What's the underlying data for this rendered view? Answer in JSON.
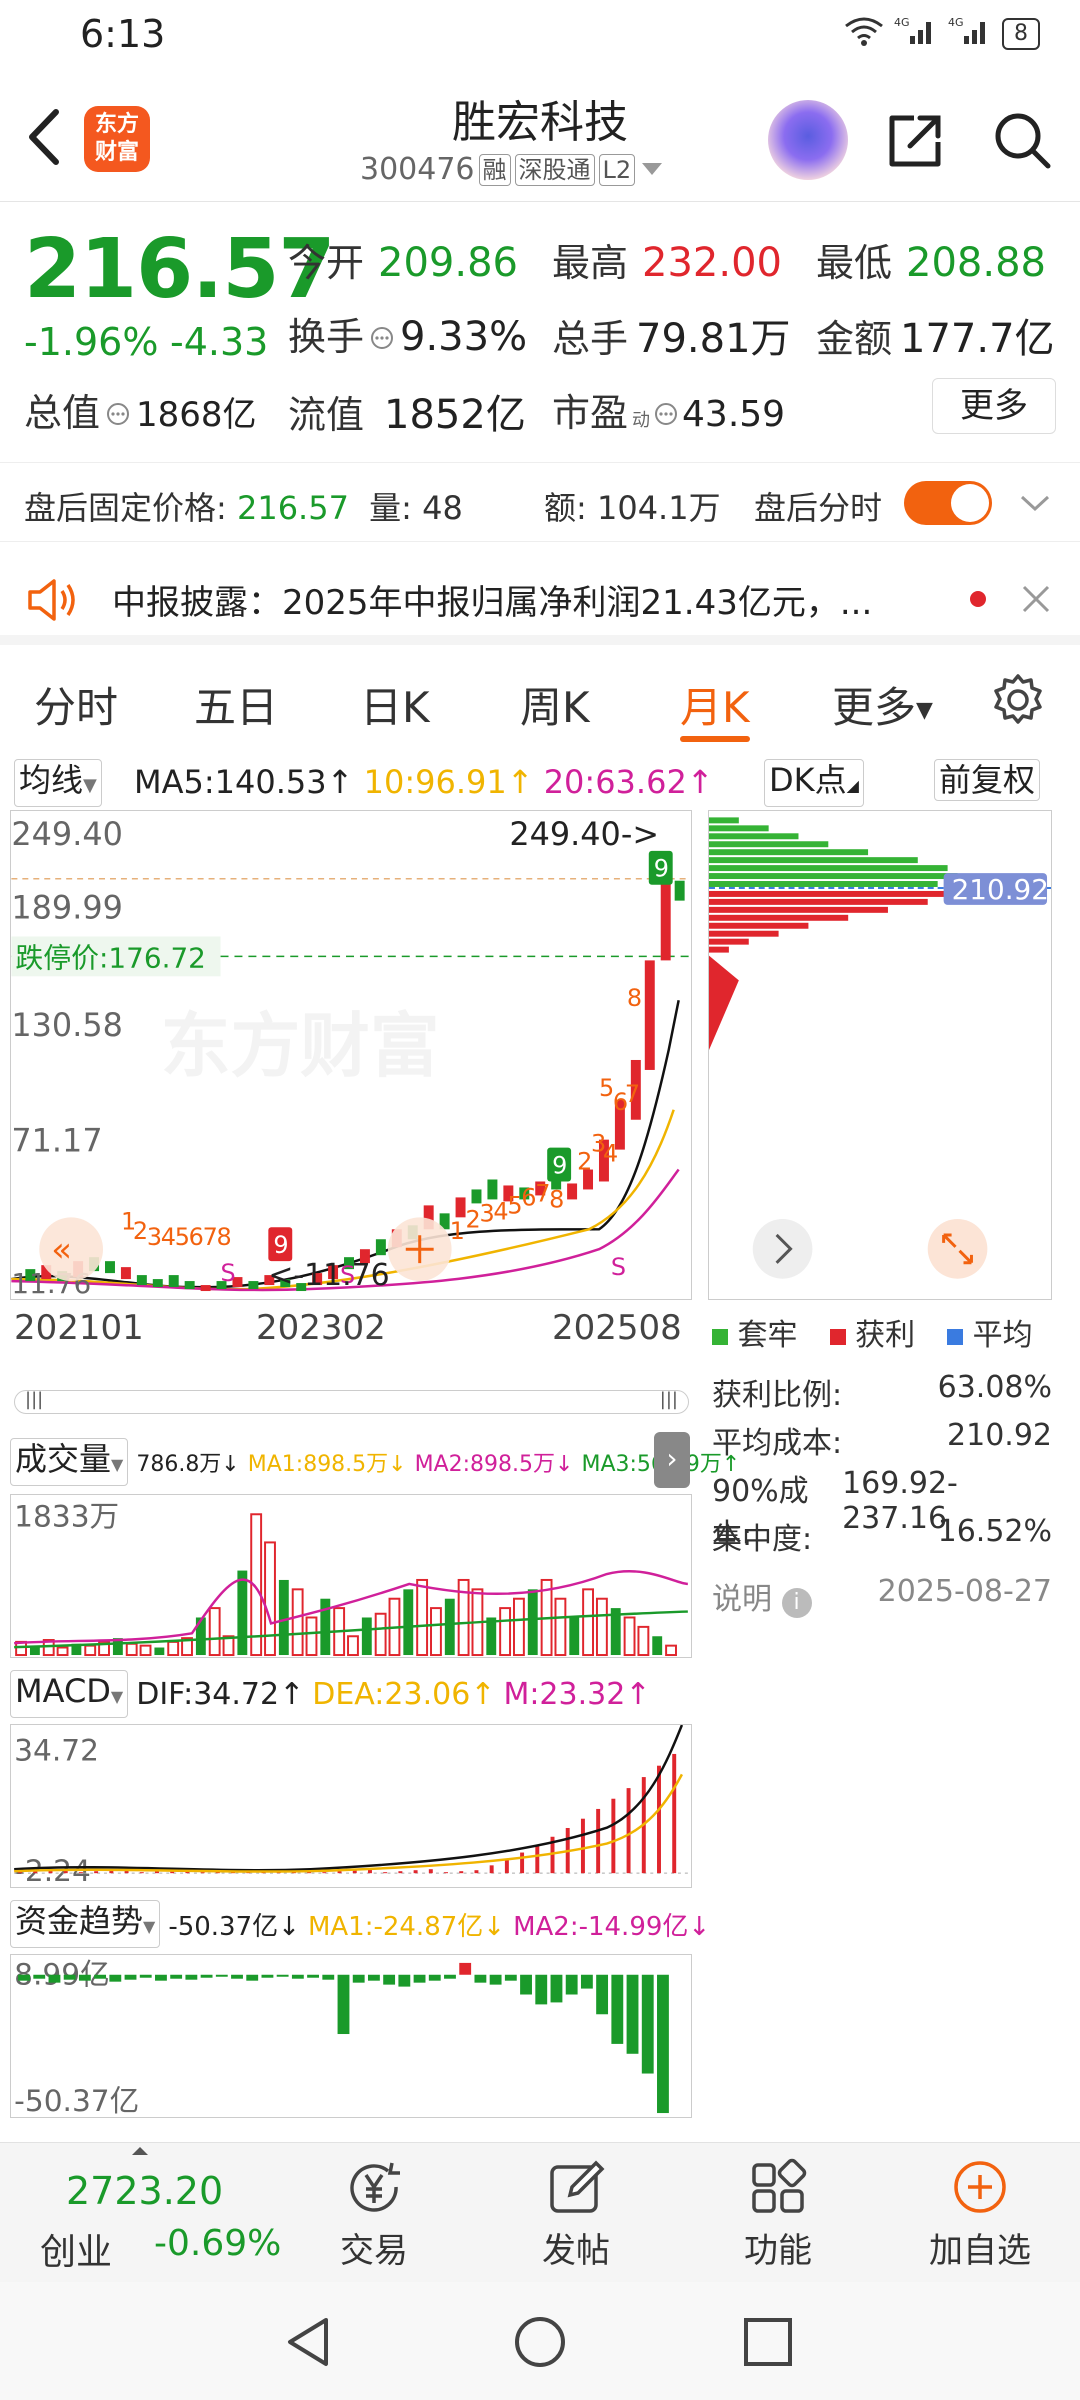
{
  "status_bar": {
    "time": "6:13",
    "signal": "4G",
    "battery": "8"
  },
  "header": {
    "stock_name": "胜宏科技",
    "stock_code": "300476",
    "tags": [
      "融",
      "深股通",
      "L2"
    ],
    "logo_text": "东方\n财富",
    "logo_line1": "东方",
    "logo_line2": "财富"
  },
  "quote": {
    "price": "216.57",
    "change_pct": "-1.96%",
    "change_abs": "-4.33",
    "open_label": "今开",
    "open": "209.86",
    "high_label": "最高",
    "high": "232.00",
    "low_label": "最低",
    "low": "208.88",
    "turnover_label": "换手",
    "turnover": "9.33%",
    "volume_label": "总手",
    "volume": "79.81万",
    "amount_label": "金额",
    "amount": "177.7亿",
    "mktcap_label": "总值",
    "mktcap": "1868亿",
    "float_label": "流值",
    "float": "1852亿",
    "pe_label": "市盈",
    "pe_sup": "动",
    "pe": "43.59",
    "more_label": "更多"
  },
  "after_hours": {
    "label": "盘后固定价格:",
    "price": "216.57",
    "vol_label": "量:",
    "vol": "48",
    "amt_label": "额:",
    "amt": "104.1万",
    "minute_label": "盘后分时"
  },
  "news": {
    "text": "中报披露：2025年中报归属净利润21.43亿元，..."
  },
  "tabs": [
    "分时",
    "五日",
    "日K",
    "周K",
    "月K",
    "更多"
  ],
  "active_tab": "月K",
  "indicators": {
    "ma_select": "均线",
    "ma5": "MA5:140.53↑",
    "ma10": "10:96.91↑",
    "ma20": "20:63.62↑",
    "dk_select": "DK点",
    "adjust_select": "前复权"
  },
  "chart": {
    "y_labels": [
      "249.40",
      "189.99",
      "130.58",
      "71.17",
      "11.76"
    ],
    "top_marker": "249.40->",
    "limit_down": "跌停价:176.72",
    "low_marker": "<-11.76",
    "x_labels": [
      "202101",
      "202302",
      "202508"
    ],
    "watermark": "东方财富",
    "colors": {
      "up": "#e0262d",
      "down": "#1a9a2a",
      "ma5": "#111111",
      "ma10": "#f0b400",
      "ma20": "#d0209a"
    }
  },
  "chip": {
    "avg_cost_tag": "210.92",
    "legend": [
      "套牢",
      "获利",
      "平均"
    ],
    "rows": [
      {
        "label": "获利比例:",
        "value": "63.08%"
      },
      {
        "label": "平均成本:",
        "value": "210.92"
      },
      {
        "label": "90%成本:",
        "value": "169.92-237.16"
      },
      {
        "label": "集中度:",
        "value": "16.52%"
      }
    ],
    "note_label": "说明",
    "date": "2025-08-27"
  },
  "volume_panel": {
    "select": "成交量",
    "value": "786.8万↓",
    "ma1": "MA1:898.5万↓",
    "ma2": "MA2:898.5万↓",
    "ma3": "MA3:565.9万↑",
    "y_label": "1833万"
  },
  "macd_panel": {
    "select": "MACD",
    "dif": "DIF:34.72↑",
    "dea": "DEA:23.06↑",
    "m": "M:23.32↑",
    "y_top": "34.72",
    "y_bottom": "-2.24"
  },
  "fund_panel": {
    "select": "资金趋势",
    "value": "-50.37亿↓",
    "ma1": "MA1:-24.87亿↓",
    "ma2": "MA2:-14.99亿↓",
    "y_top": "8.99亿",
    "y_bottom": "-50.37亿"
  },
  "bottom_nav": {
    "index_value": "2723.20",
    "index_name": "创业",
    "index_change": "-0.69%",
    "items": [
      "交易",
      "发帖",
      "功能",
      "加自选"
    ]
  }
}
